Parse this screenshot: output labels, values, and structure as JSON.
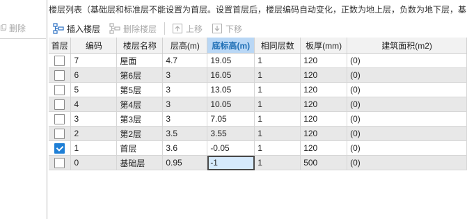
{
  "left_panel": {
    "delete_label": "删除",
    "delete_icon": "copy-icon"
  },
  "title": "楼层列表（基础层和标准层不能设置为首层。设置首层后，楼层编码自动变化，正数为地上层，负数为地下层，基",
  "toolbar": {
    "insert_label": "插入楼层",
    "delete_label": "删除楼层",
    "up_label": "上移",
    "down_label": "下移"
  },
  "table": {
    "columns": [
      "首层",
      "编码",
      "楼层名称",
      "层高(m)",
      "底标高(m)",
      "相同层数",
      "板厚(mm)",
      "建筑面积(m2)"
    ],
    "active_column_index": 4,
    "rows": [
      {
        "first_floor": false,
        "code": "7",
        "name": "屋面",
        "height": "4.7",
        "bottom_elev": "19.05",
        "same_count": "1",
        "slab": "120",
        "area": "(0)"
      },
      {
        "first_floor": false,
        "code": "6",
        "name": "第6层",
        "height": "3",
        "bottom_elev": "16.05",
        "same_count": "1",
        "slab": "120",
        "area": "(0)"
      },
      {
        "first_floor": false,
        "code": "5",
        "name": "第5层",
        "height": "3",
        "bottom_elev": "13.05",
        "same_count": "1",
        "slab": "120",
        "area": "(0)"
      },
      {
        "first_floor": false,
        "code": "4",
        "name": "第4层",
        "height": "3",
        "bottom_elev": "10.05",
        "same_count": "1",
        "slab": "120",
        "area": "(0)"
      },
      {
        "first_floor": false,
        "code": "3",
        "name": "第3层",
        "height": "3",
        "bottom_elev": "7.05",
        "same_count": "1",
        "slab": "120",
        "area": "(0)"
      },
      {
        "first_floor": false,
        "code": "2",
        "name": "第2层",
        "height": "3.5",
        "bottom_elev": "3.55",
        "same_count": "1",
        "slab": "120",
        "area": "(0)"
      },
      {
        "first_floor": true,
        "code": "1",
        "name": "首层",
        "height": "3.6",
        "bottom_elev": "-0.05",
        "same_count": "1",
        "slab": "120",
        "area": "(0)"
      },
      {
        "first_floor": false,
        "code": "0",
        "name": "基础层",
        "height": "0.95",
        "bottom_elev": "-1",
        "same_count": "1",
        "slab": "500",
        "area": "(0)"
      }
    ],
    "editing_row_index": 7
  },
  "colors": {
    "accent": "#1e7fd6",
    "header_active_bg": "#b9d7f5",
    "row_alt_bg": "#e8e8e8"
  }
}
